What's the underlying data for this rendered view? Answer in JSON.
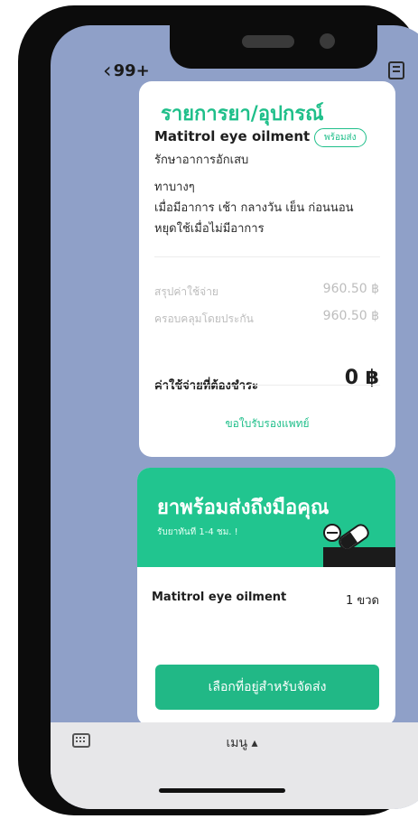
{
  "header": {
    "back_label": "99+",
    "back_icon": "chevron-left-icon",
    "doc_icon": "document-icon",
    "menu_icon": "hamburger-menu-icon"
  },
  "medicine_card": {
    "title": "รายการยา/อุปกรณ์",
    "item_name": "Matitrol eye oilment",
    "badge": "พร้อมส่ง",
    "purpose": "รักษาอาการอักเสบ",
    "usage_line1": "ทาบางๆ",
    "usage_line2": "เมื่อมีอาการ เช้า กลางวัน เย็น ก่อนนอน",
    "usage_line3": "หยุดใช้เมื่อไม่มีอาการ",
    "summary_label": "สรุปค่าใช้จ่าย",
    "summary_value": "960.50 ฿",
    "coverage_label": "ครอบคลุมโดยประกัน",
    "coverage_value": "960.50 ฿",
    "payable_label": "ค่าใช้จ่ายที่ต้องชำระ",
    "payable_value": "0 ฿",
    "link_label": "ขอใบรับรองแพทย์"
  },
  "delivery_card": {
    "banner_title": "ยาพร้อมส่งถึงมือคุณ",
    "banner_subtitle": "รับยาทันที 1-4 ชม. !",
    "banner_icon": "pill-icon",
    "item_name": "Matitrol eye oilment",
    "item_qty": "1 ขวด",
    "cta_label": "เลือกที่อยู่สำหรับจัดส่ง"
  },
  "bottom_bar": {
    "keyboard_icon": "keyboard-icon",
    "menu_label": "เมนู ▴"
  },
  "colors": {
    "accent": "#1fbf8a",
    "banner": "#21c58f",
    "background": "#8fa0c8"
  }
}
